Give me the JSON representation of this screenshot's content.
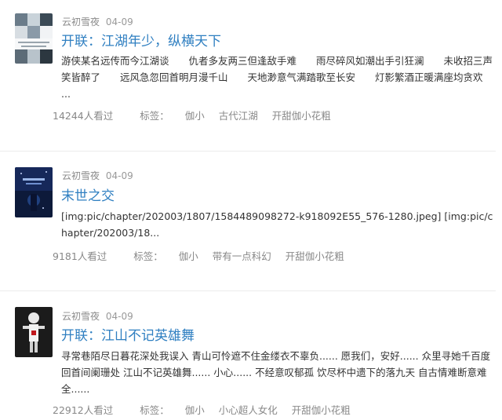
{
  "posts": [
    {
      "author": "云初雪夜",
      "date": "04-09",
      "title": "开联：江湖年少，纵横天下",
      "summary": "游侠某名远传而今江湖谈　　仇者多友两三但逢敌手难　　雨尽碎风如潮出手引狂澜　　未收招三声笑皆醉了　　远风急忽回首明月漫千山　　天地渺意气满踏歌至长安　　灯影繁酒正暖满座均贪欢　　...",
      "views": "14244人看过",
      "tags_label": "标签：",
      "tags": [
        "伽小",
        "古代江湖",
        "开甜伽小花粗"
      ]
    },
    {
      "author": "云初雪夜",
      "date": "04-09",
      "title": "末世之交",
      "summary": "[img:pic/chapter/202003/1807/1584489098272-k918092E55_576-1280.jpeg] [img:pic/chapter/202003/18...",
      "views": "9181人看过",
      "tags_label": "标签：",
      "tags": [
        "伽小",
        "带有一点科幻",
        "开甜伽小花粗"
      ]
    },
    {
      "author": "云初雪夜",
      "date": "04-09",
      "title": "开联：江山不记英雄舞",
      "summary": "寻常巷陌尽日暮花深处我误入 青山可怜遮不住金缕衣不辜负...... 愿我们，安好...... 众里寻她千百度回首间阑珊处 江山不记英雄舞...... 小心...... 不经意叹郁孤 饮尽杯中遗下的落九天 自古情难断意难全......",
      "views": "22912人看过",
      "tags_label": "标签：",
      "tags": [
        "伽小",
        "小心超人女化",
        "开甜伽小花粗"
      ]
    }
  ]
}
